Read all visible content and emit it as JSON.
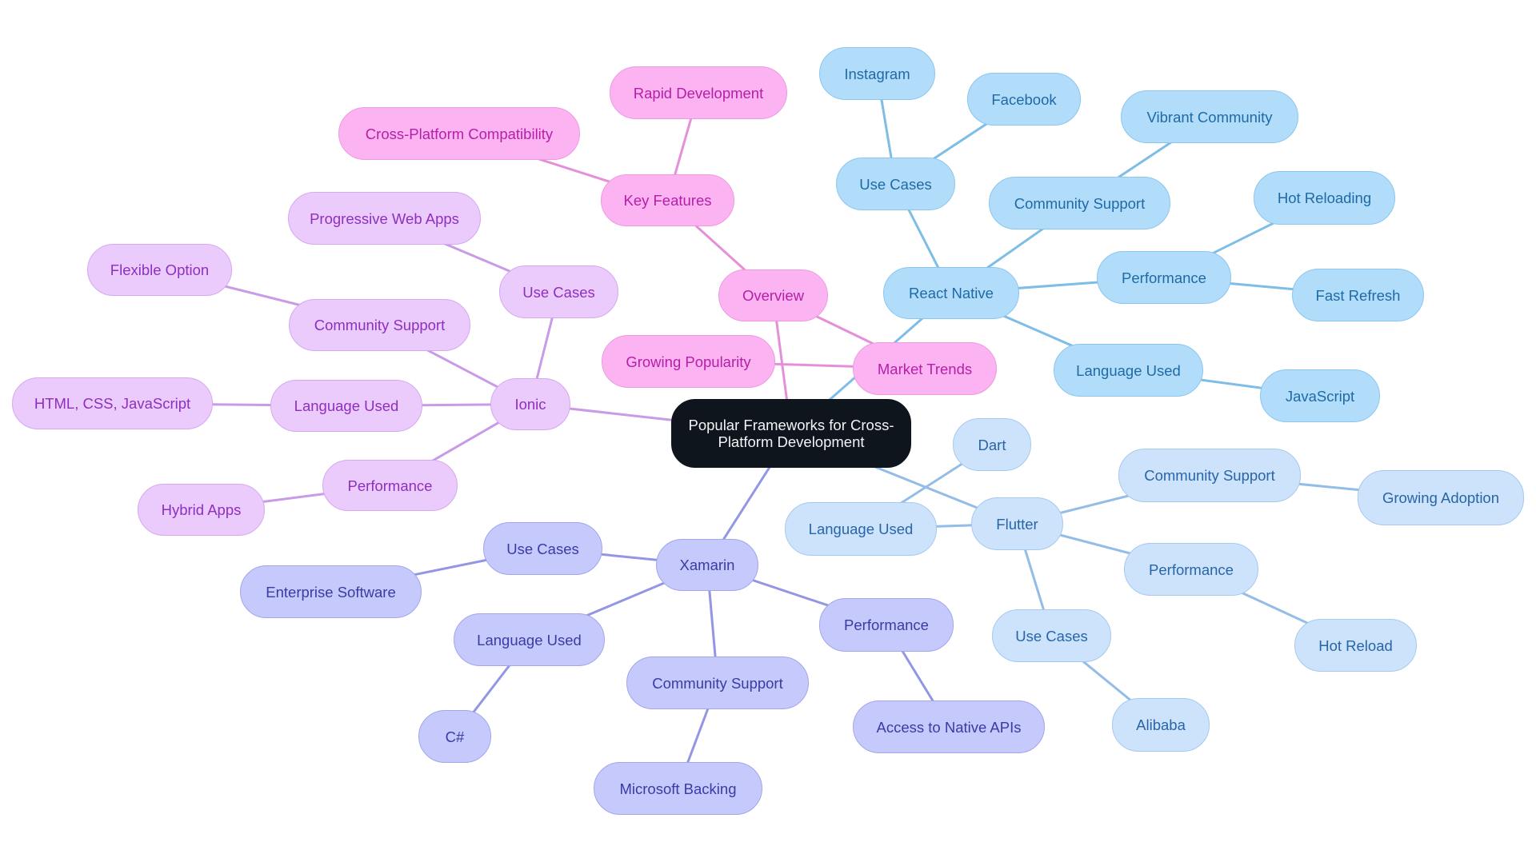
{
  "diagram": {
    "type": "mindmap",
    "root": "Popular Frameworks for Cross-Platform Development",
    "colors": {
      "root": "#0e151d",
      "pink_branch": "#fcb3f2",
      "violet_branch": "#eacbfb",
      "blue_branch": "#b1ddfb",
      "light_blue_branch": "#cde3fb",
      "indigo_branch": "#c6c9fb"
    },
    "nodes": {
      "root": "Popular Frameworks for Cross-Platform Development",
      "overview": "Overview",
      "key_features": "Key Features",
      "rapid_development": "Rapid Development",
      "cross_platform_compat": "Cross-Platform Compatibility",
      "market_trends": "Market Trends",
      "growing_popularity": "Growing Popularity",
      "ionic": "Ionic",
      "ionic_use_cases": "Use Cases",
      "pwa": "Progressive Web Apps",
      "ionic_community": "Community Support",
      "flexible_option": "Flexible Option",
      "ionic_language": "Language Used",
      "html_css_js": "HTML, CSS, JavaScript",
      "ionic_performance": "Performance",
      "hybrid_apps": "Hybrid Apps",
      "react_native": "React Native",
      "rn_use_cases": "Use Cases",
      "instagram": "Instagram",
      "facebook": "Facebook",
      "rn_community": "Community Support",
      "vibrant_community": "Vibrant Community",
      "rn_performance": "Performance",
      "hot_reloading": "Hot Reloading",
      "fast_refresh": "Fast Refresh",
      "rn_language": "Language Used",
      "javascript": "JavaScript",
      "flutter": "Flutter",
      "flutter_language": "Language Used",
      "dart": "Dart",
      "flutter_community": "Community Support",
      "growing_adoption": "Growing Adoption",
      "flutter_performance": "Performance",
      "hot_reload": "Hot Reload",
      "flutter_use_cases": "Use Cases",
      "alibaba": "Alibaba",
      "xamarin": "Xamarin",
      "xamarin_use_cases": "Use Cases",
      "enterprise_software": "Enterprise Software",
      "xamarin_language": "Language Used",
      "csharp": "C#",
      "xamarin_community": "Community Support",
      "microsoft_backing": "Microsoft Backing",
      "xamarin_performance": "Performance",
      "native_apis": "Access to Native APIs"
    },
    "edges": [
      [
        "root",
        "overview"
      ],
      [
        "overview",
        "key_features"
      ],
      [
        "key_features",
        "rapid_development"
      ],
      [
        "key_features",
        "cross_platform_compat"
      ],
      [
        "overview",
        "market_trends"
      ],
      [
        "market_trends",
        "growing_popularity"
      ],
      [
        "root",
        "ionic"
      ],
      [
        "ionic",
        "ionic_use_cases"
      ],
      [
        "ionic_use_cases",
        "pwa"
      ],
      [
        "ionic",
        "ionic_community"
      ],
      [
        "ionic_community",
        "flexible_option"
      ],
      [
        "ionic",
        "ionic_language"
      ],
      [
        "ionic_language",
        "html_css_js"
      ],
      [
        "ionic",
        "ionic_performance"
      ],
      [
        "ionic_performance",
        "hybrid_apps"
      ],
      [
        "root",
        "react_native"
      ],
      [
        "react_native",
        "rn_use_cases"
      ],
      [
        "rn_use_cases",
        "instagram"
      ],
      [
        "rn_use_cases",
        "facebook"
      ],
      [
        "react_native",
        "rn_community"
      ],
      [
        "rn_community",
        "vibrant_community"
      ],
      [
        "react_native",
        "rn_performance"
      ],
      [
        "rn_performance",
        "hot_reloading"
      ],
      [
        "rn_performance",
        "fast_refresh"
      ],
      [
        "react_native",
        "rn_language"
      ],
      [
        "rn_language",
        "javascript"
      ],
      [
        "root",
        "flutter"
      ],
      [
        "flutter",
        "flutter_language"
      ],
      [
        "flutter_language",
        "dart"
      ],
      [
        "flutter",
        "flutter_community"
      ],
      [
        "flutter_community",
        "growing_adoption"
      ],
      [
        "flutter",
        "flutter_performance"
      ],
      [
        "flutter_performance",
        "hot_reload"
      ],
      [
        "flutter",
        "flutter_use_cases"
      ],
      [
        "flutter_use_cases",
        "alibaba"
      ],
      [
        "root",
        "xamarin"
      ],
      [
        "xamarin",
        "xamarin_use_cases"
      ],
      [
        "xamarin_use_cases",
        "enterprise_software"
      ],
      [
        "xamarin",
        "xamarin_language"
      ],
      [
        "xamarin_language",
        "csharp"
      ],
      [
        "xamarin",
        "xamarin_community"
      ],
      [
        "xamarin_community",
        "microsoft_backing"
      ],
      [
        "xamarin",
        "xamarin_performance"
      ],
      [
        "xamarin_performance",
        "native_apis"
      ]
    ]
  }
}
